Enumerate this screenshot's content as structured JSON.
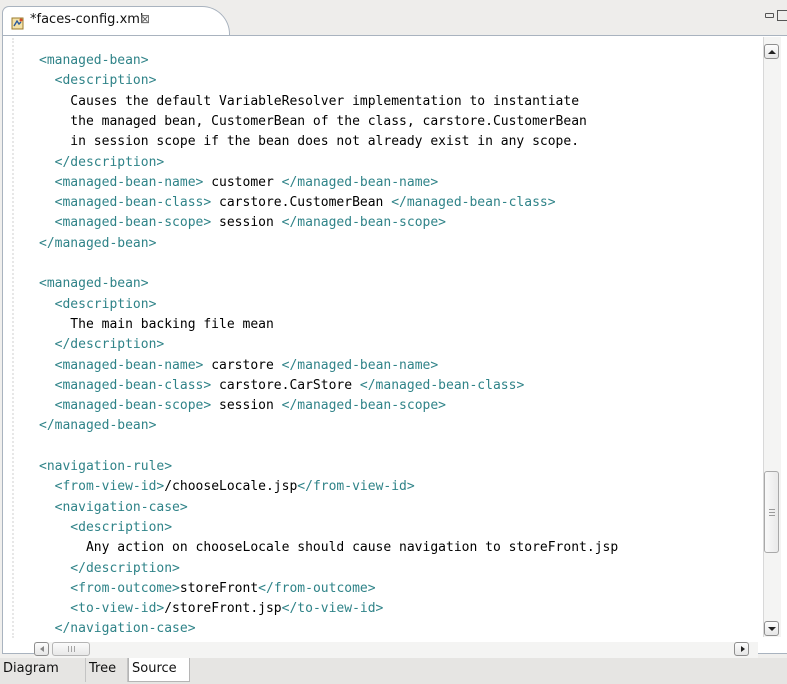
{
  "tab": {
    "title": "*faces-config.xml",
    "close_glyph": "⊠",
    "icon": "xml-file-icon"
  },
  "window_controls": {
    "minimize_icon": "minimize-icon",
    "maximize_icon": "maximize-icon"
  },
  "colors": {
    "tag": "#2f8388",
    "text": "#000000",
    "background": "#ffffff"
  },
  "code_lines": [
    [
      [
        "tag",
        "<managed-bean>"
      ]
    ],
    [
      [
        "tag",
        "  <description>"
      ]
    ],
    [
      [
        "text",
        "    Causes the default VariableResolver implementation to instantiate"
      ]
    ],
    [
      [
        "text",
        "    the managed bean, CustomerBean of the class, carstore.CustomerBean"
      ]
    ],
    [
      [
        "text",
        "    in session scope if the bean does not already exist in any scope."
      ]
    ],
    [
      [
        "tag",
        "  </description>"
      ]
    ],
    [
      [
        "tag",
        "  <managed-bean-name>"
      ],
      [
        "text",
        " customer "
      ],
      [
        "tag",
        "</managed-bean-name>"
      ]
    ],
    [
      [
        "tag",
        "  <managed-bean-class>"
      ],
      [
        "text",
        " carstore.CustomerBean "
      ],
      [
        "tag",
        "</managed-bean-class>"
      ]
    ],
    [
      [
        "tag",
        "  <managed-bean-scope>"
      ],
      [
        "text",
        " session "
      ],
      [
        "tag",
        "</managed-bean-scope>"
      ]
    ],
    [
      [
        "tag",
        "</managed-bean>"
      ]
    ],
    [
      [
        "text",
        ""
      ]
    ],
    [
      [
        "tag",
        "<managed-bean>"
      ]
    ],
    [
      [
        "tag",
        "  <description>"
      ]
    ],
    [
      [
        "text",
        "    The main backing file mean"
      ]
    ],
    [
      [
        "tag",
        "  </description>"
      ]
    ],
    [
      [
        "tag",
        "  <managed-bean-name>"
      ],
      [
        "text",
        " carstore "
      ],
      [
        "tag",
        "</managed-bean-name>"
      ]
    ],
    [
      [
        "tag",
        "  <managed-bean-class>"
      ],
      [
        "text",
        " carstore.CarStore "
      ],
      [
        "tag",
        "</managed-bean-class>"
      ]
    ],
    [
      [
        "tag",
        "  <managed-bean-scope>"
      ],
      [
        "text",
        " session "
      ],
      [
        "tag",
        "</managed-bean-scope>"
      ]
    ],
    [
      [
        "tag",
        "</managed-bean>"
      ]
    ],
    [
      [
        "text",
        ""
      ]
    ],
    [
      [
        "tag",
        "<navigation-rule>"
      ]
    ],
    [
      [
        "tag",
        "  <from-view-id>"
      ],
      [
        "text",
        "/chooseLocale.jsp"
      ],
      [
        "tag",
        "</from-view-id>"
      ]
    ],
    [
      [
        "tag",
        "  <navigation-case>"
      ]
    ],
    [
      [
        "tag",
        "    <description>"
      ]
    ],
    [
      [
        "text",
        "      Any action on chooseLocale should cause navigation to storeFront.jsp"
      ]
    ],
    [
      [
        "tag",
        "    </description>"
      ]
    ],
    [
      [
        "tag",
        "    <from-outcome>"
      ],
      [
        "text",
        "storeFront"
      ],
      [
        "tag",
        "</from-outcome>"
      ]
    ],
    [
      [
        "tag",
        "    <to-view-id>"
      ],
      [
        "text",
        "/storeFront.jsp"
      ],
      [
        "tag",
        "</to-view-id>"
      ]
    ],
    [
      [
        "tag",
        "  </navigation-case>"
      ]
    ]
  ],
  "bottom_tabs": [
    {
      "label": "Diagram",
      "active": false
    },
    {
      "label": "Tree",
      "active": false
    },
    {
      "label": "Source",
      "active": true
    }
  ]
}
